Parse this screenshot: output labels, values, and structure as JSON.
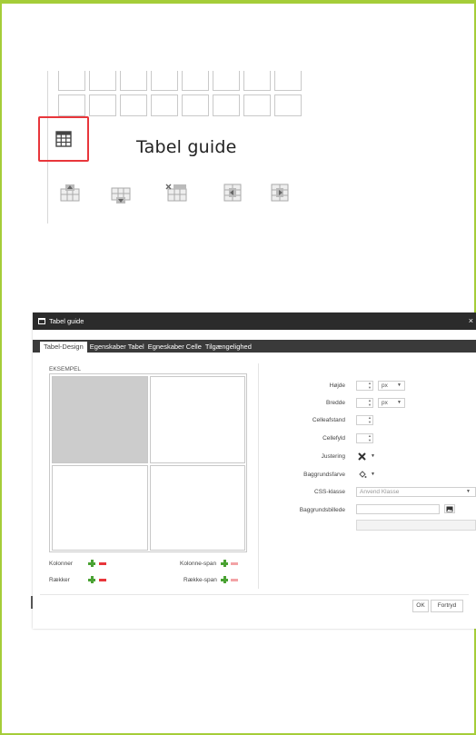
{
  "toolbar": {
    "title": "Tabel guide"
  },
  "dialog": {
    "title": "Tabel guide",
    "close": "×",
    "tabs": [
      "Tabel-Design",
      "Egenskaber Tabel",
      "Egneskaber Celle",
      "Tilgængelighed"
    ],
    "active_tab": "Tabel-Design",
    "preview_label": "EKSEMPEL",
    "left_controls": {
      "columns": "Kolonner",
      "rows": "Rækker",
      "colspan": "Kolonne-span",
      "rowspan": "Række-span"
    },
    "fields": {
      "height": "Højde",
      "width": "Bredde",
      "cellspacing": "Celleafstand",
      "cellpadding": "Cellefyld",
      "alignment": "Justering",
      "bgcolor": "Baggrundsfarve",
      "css_class": "CSS-klasse",
      "bgimage": "Baggrundsbillede"
    },
    "unit_px": "px",
    "css_placeholder": "Anvend Klasse",
    "ok_label": "OK",
    "cancel_label": "Fortryd"
  },
  "colors": {
    "frame_border": "#a5cd39",
    "highlight": "#e8363b",
    "plus": "#4aa233",
    "selected_cell": "#cccccc",
    "titlebar": "#2b2b2b"
  }
}
